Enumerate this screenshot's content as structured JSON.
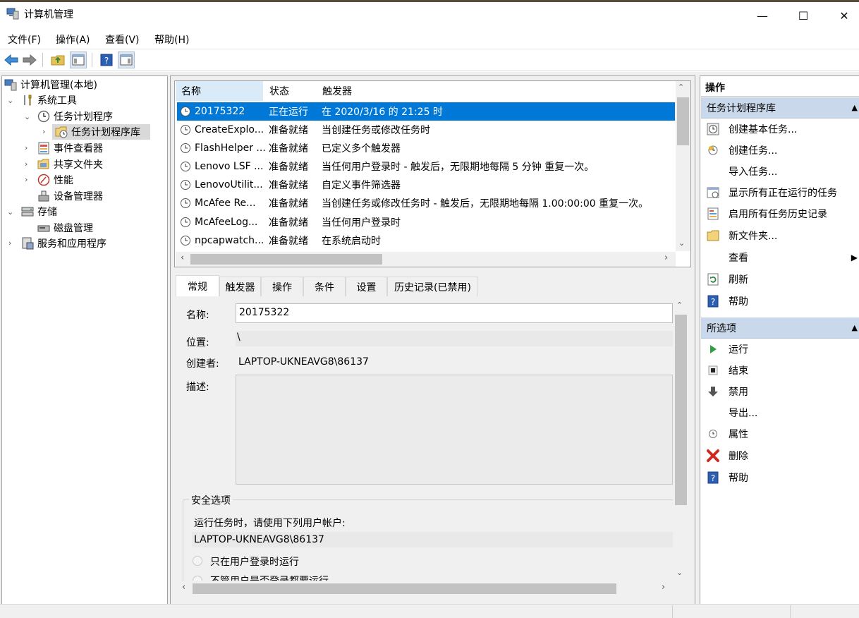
{
  "window": {
    "title": "计算机管理",
    "minimize": "—",
    "maximize": "☐",
    "close": "✕"
  },
  "menu": [
    "文件(F)",
    "操作(A)",
    "查看(V)",
    "帮助(H)"
  ],
  "tree": {
    "root": "计算机管理(本地)",
    "system_tools": "系统工具",
    "task_scheduler": "任务计划程序",
    "task_library": "任务计划程序库",
    "event_viewer": "事件查看器",
    "shared_folders": "共享文件夹",
    "performance": "性能",
    "device_manager": "设备管理器",
    "storage": "存储",
    "disk_management": "磁盘管理",
    "services_apps": "服务和应用程序"
  },
  "task_list": {
    "headers": [
      "名称",
      "状态",
      "触发器"
    ],
    "rows": [
      {
        "name": "20175322",
        "status": "正在运行",
        "trigger": "在 2020/3/16 的 21:25 时"
      },
      {
        "name": "CreateExplo...",
        "status": "准备就绪",
        "trigger": "当创建任务或修改任务时"
      },
      {
        "name": "FlashHelper ...",
        "status": "准备就绪",
        "trigger": "已定义多个触发器"
      },
      {
        "name": "Lenovo LSF ...",
        "status": "准备就绪",
        "trigger": "当任何用户登录时 - 触发后，无限期地每隔 5 分钟 重复一次。"
      },
      {
        "name": "LenovoUtilit...",
        "status": "准备就绪",
        "trigger": "自定义事件筛选器"
      },
      {
        "name": "McAfee Re...",
        "status": "准备就绪",
        "trigger": "当创建任务或修改任务时 - 触发后，无限期地每隔 1.00:00:00 重复一次。"
      },
      {
        "name": "McAfeeLog...",
        "status": "准备就绪",
        "trigger": "当任何用户登录时"
      },
      {
        "name": "npcapwatch...",
        "status": "准备就绪",
        "trigger": "在系统启动时"
      }
    ]
  },
  "tabs": [
    "常规",
    "触发器",
    "操作",
    "条件",
    "设置",
    "历史记录(已禁用)"
  ],
  "general": {
    "name_label": "名称:",
    "name_value": "20175322",
    "location_label": "位置:",
    "location_value": "\\",
    "author_label": "创建者:",
    "author_value": "LAPTOP-UKNEAVG8\\86137",
    "desc_label": "描述:",
    "security_group": "安全选项",
    "run_as_label": "运行任务时，请使用下列用户帐户:",
    "run_as_value": "LAPTOP-UKNEAVG8\\86137",
    "radio1": "只在用户登录时运行",
    "radio2": "不管用户是否登录都要运行"
  },
  "actions": {
    "pane_title": "操作",
    "section1": "任务计划程序库",
    "section1_items": [
      "创建基本任务...",
      "创建任务...",
      "导入任务...",
      "显示所有正在运行的任务",
      "启用所有任务历史记录",
      "新文件夹...",
      "查看",
      "刷新",
      "帮助"
    ],
    "section2": "所选项",
    "section2_items": [
      "运行",
      "结束",
      "禁用",
      "导出...",
      "属性",
      "删除",
      "帮助"
    ]
  },
  "colors": {
    "selection": "#0078d7",
    "section_header": "#c9d8ea"
  }
}
